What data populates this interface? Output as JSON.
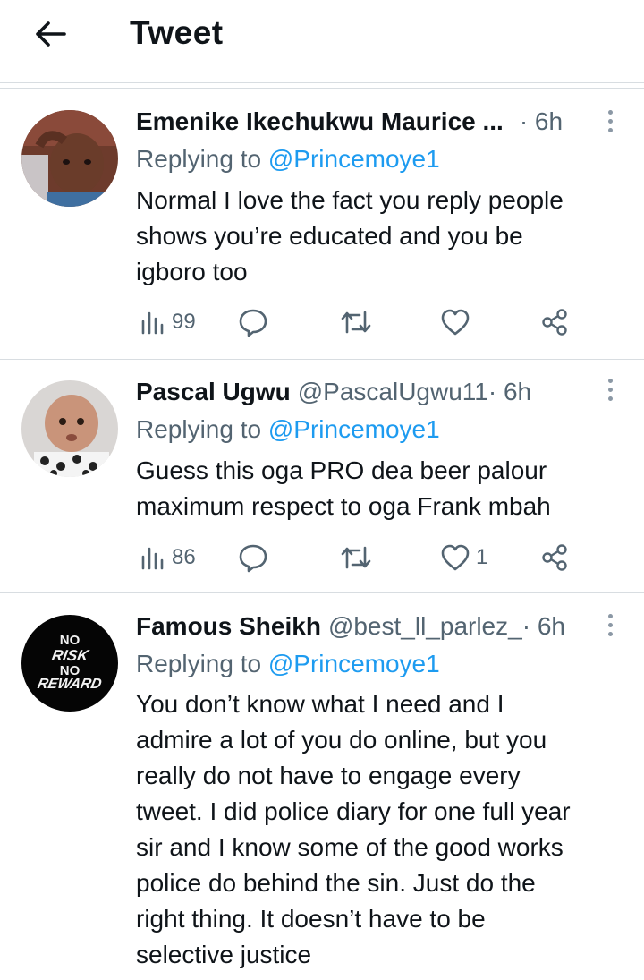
{
  "header": {
    "title": "Tweet",
    "back_icon": "arrow-left-icon"
  },
  "colors": {
    "link": "#1d9bf0",
    "secondary_text": "#536471",
    "primary_text": "#0f1419",
    "divider": "#d8dde1"
  },
  "tweets": [
    {
      "name": "Emenike Ikechukwu Maurice ...",
      "handle": "",
      "time": "· 6h",
      "replying_prefix": "Replying to ",
      "replying_to": "@Princemoye1",
      "lines": [
        "Normal I love the fact you reply people",
        "shows you’re educated and you be",
        "igboro too"
      ],
      "views": "99",
      "likes": ""
    },
    {
      "name": "Pascal Ugwu",
      "handle": "@PascalUgwu11",
      "time": " · 6h",
      "replying_prefix": "Replying to ",
      "replying_to": "@Princemoye1",
      "lines": [
        "Guess this oga PRO dea beer palour",
        "maximum respect to oga Frank mbah"
      ],
      "views": "86",
      "likes": "1"
    },
    {
      "name": "Famous Sheikh",
      "handle": "@best_ll_parlez_",
      "time": " · 6h",
      "replying_prefix": "Replying to ",
      "replying_to": "@Princemoye1",
      "avatar_text": [
        "NO",
        "RISK",
        "NO",
        "REWARD"
      ],
      "lines": [
        "You don’t know what I need and I",
        "admire a lot of you do online, but you",
        "really do not have to engage every",
        "tweet. I did police diary for one full year",
        "sir and I know some of the good works",
        "police do behind the sin. Just do the",
        "right thing. It doesn’t have to be",
        "selective justice"
      ]
    }
  ]
}
